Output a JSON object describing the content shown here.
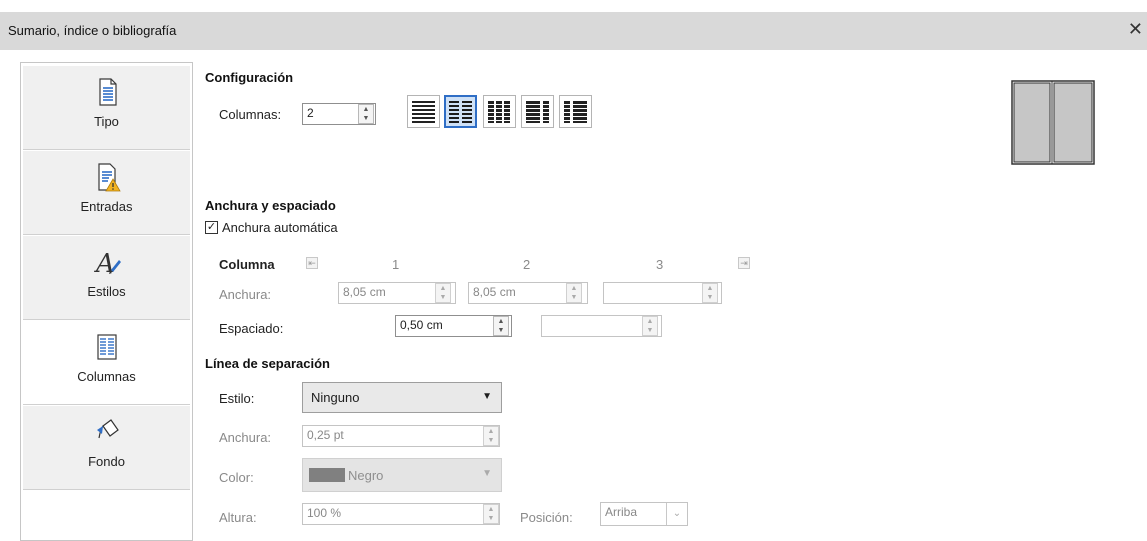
{
  "window": {
    "title": "Sumario, índice o bibliografía",
    "close_glyph": "✕"
  },
  "sidebar": {
    "tabs": [
      {
        "label": "Tipo",
        "icon": "document-icon"
      },
      {
        "label": "Entradas",
        "icon": "entries-warning-icon"
      },
      {
        "label": "Estilos",
        "icon": "styles-brush-icon"
      },
      {
        "label": "Columnas",
        "icon": "columns-icon",
        "active": true
      },
      {
        "label": "Fondo",
        "icon": "paint-bucket-icon"
      }
    ]
  },
  "config": {
    "heading": "Configuración",
    "columns_label": "Columnas:",
    "columns_value": "2",
    "layouts": [
      "one-column",
      "two-columns",
      "three-columns",
      "two-left-larger",
      "two-right-larger"
    ],
    "selected_layout": "two-columns"
  },
  "width": {
    "heading": "Anchura y espaciado",
    "auto_label": "Anchura automática",
    "auto_checked": true,
    "column_label": "Columna",
    "col_numbers": [
      "1",
      "2",
      "3"
    ],
    "anchura_label": "Anchura:",
    "widths": [
      "8,05 cm",
      "8,05 cm",
      ""
    ],
    "spacing_label": "Espaciado:",
    "spacings": [
      "0,50 cm",
      ""
    ]
  },
  "separator": {
    "heading": "Línea de separación",
    "style_label": "Estilo:",
    "style_value": "Ninguno",
    "width_label": "Anchura:",
    "width_value": "0,25 pt",
    "color_label": "Color:",
    "color_value": "Negro",
    "color_swatch": "#808080",
    "height_label": "Altura:",
    "height_value": "100 %",
    "position_label": "Posición:",
    "position_value": "Arriba"
  },
  "colors": {
    "accent": "#2f6ec6",
    "titlebar": "#d9d9d9"
  }
}
